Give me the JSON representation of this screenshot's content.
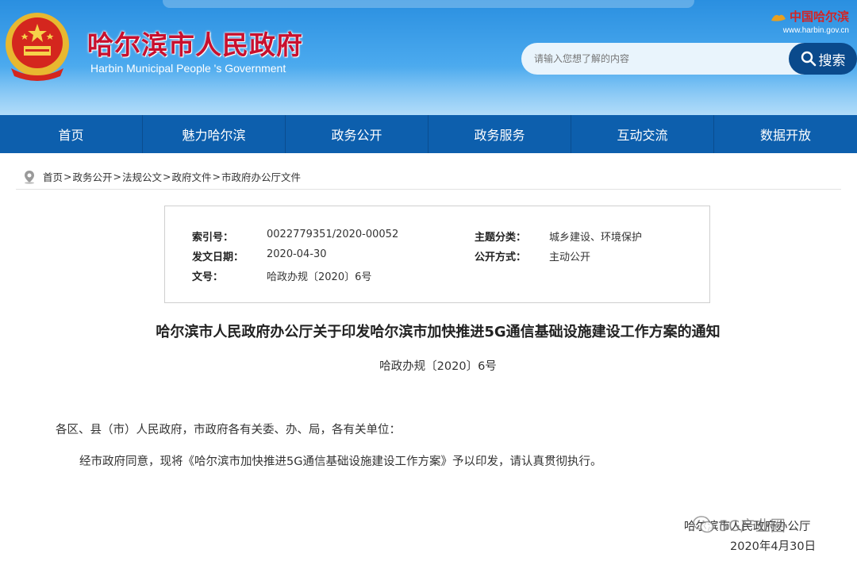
{
  "header": {
    "title": "哈尔滨市人民政府",
    "subtitle": "Harbin Municipal People 's Government",
    "brand_cn": "中国哈尔滨",
    "brand_url": "www.harbin.gov.cn",
    "search_placeholder": "请输入您想了解的内容",
    "search_button": "搜索"
  },
  "nav": [
    "首页",
    "魅力哈尔滨",
    "政务公开",
    "政务服务",
    "互动交流",
    "数据开放"
  ],
  "breadcrumb": [
    "首页",
    "政务公开",
    "法规公文",
    "政府文件",
    "市政府办公厅文件"
  ],
  "info": {
    "index_label": "索引号：",
    "index_value": "0022779351/2020-00052",
    "date_label": "发文日期：",
    "date_value": "2020-04-30",
    "docno_label": "文号：",
    "docno_value": "哈政办规〔2020〕6号",
    "topic_label": "主题分类：",
    "topic_value": "城乡建设、环境保护",
    "mode_label": "公开方式：",
    "mode_value": "主动公开"
  },
  "document": {
    "title": "哈尔滨市人民政府办公厅关于印发哈尔滨市加快推进5G通信基础设施建设工作方案的通知",
    "number": "哈政办规〔2020〕6号",
    "addressee": "各区、县（市）人民政府，市政府各有关委、办、局，各有关单位：",
    "body": "经市政府同意，现将《哈尔滨市加快推进5G通信基础设施建设工作方案》予以印发，请认真贯彻执行。",
    "signature": "哈尔滨市人民政府办公厅",
    "date": "2020年4月30日"
  },
  "watermark": "5G产业圈",
  "colors": {
    "nav": "#0d5fad",
    "title_red": "#c8102e",
    "search_button": "#0a4a8c"
  }
}
